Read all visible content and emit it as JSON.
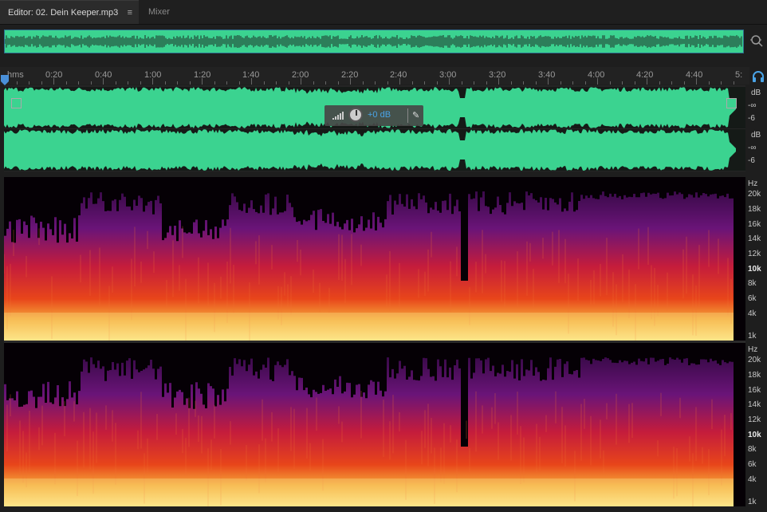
{
  "tabs": {
    "editor_label": "Editor: 02. Dein Keeper.mp3",
    "menu_glyph": "≡",
    "mixer_label": "Mixer"
  },
  "ruler": {
    "unit": "hms",
    "labels": [
      "0:20",
      "0:40",
      "1:00",
      "1:20",
      "1:40",
      "2:00",
      "2:20",
      "2:40",
      "3:00",
      "3:20",
      "3:40",
      "4:00",
      "4:20",
      "4:40",
      "5:"
    ]
  },
  "hud": {
    "volume": "+0 dB"
  },
  "amp_scale": {
    "unit": "dB",
    "inf": "-∞",
    "six": "-6"
  },
  "freq_scale": {
    "unit": "Hz",
    "labels": [
      "20k",
      "18k",
      "16k",
      "14k",
      "12k",
      "10k",
      "8k",
      "6k",
      "4k",
      "1k"
    ]
  },
  "icons": {
    "zoom": "zoom-navigator-icon",
    "loop": "headphone-icon",
    "pin": "pin-icon",
    "playhead": "playhead-marker-icon"
  },
  "colors": {
    "waveform": "#3bd390",
    "selection_border": "#2c6c8c",
    "accent": "#4aa3e6"
  }
}
